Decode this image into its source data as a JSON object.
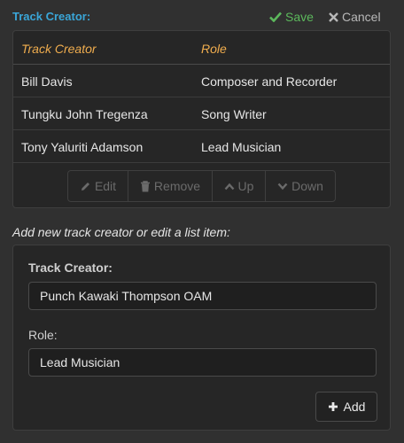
{
  "header": {
    "title": "Track Creator:",
    "save_label": "Save",
    "cancel_label": "Cancel"
  },
  "table": {
    "columns": [
      "Track Creator",
      "Role"
    ],
    "rows": [
      {
        "creator": "Bill Davis",
        "role": "Composer and Recorder"
      },
      {
        "creator": "Tungku John Tregenza",
        "role": "Song Writer"
      },
      {
        "creator": "Tony Yaluriti Adamson",
        "role": "Lead Musician"
      }
    ]
  },
  "actions": {
    "edit": "Edit",
    "remove": "Remove",
    "up": "Up",
    "down": "Down"
  },
  "form": {
    "hint": "Add new track creator or edit a list item:",
    "creator_label": "Track Creator:",
    "creator_value": "Punch Kawaki Thompson OAM",
    "role_label": "Role:",
    "role_value": "Lead Musician",
    "add_label": "Add"
  },
  "colors": {
    "accent_title": "#3aa6d8",
    "save": "#5cb85c",
    "column_header": "#f0ad4e",
    "disabled": "#6b6b6b"
  }
}
